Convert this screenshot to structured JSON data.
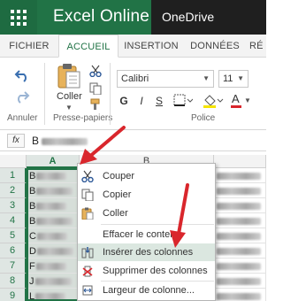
{
  "topbar": {
    "app_title": "Excel Online",
    "service": "OneDrive"
  },
  "tabs": [
    {
      "label": "FICHIER",
      "active": false
    },
    {
      "label": "ACCUEIL",
      "active": true
    },
    {
      "label": "INSERTION",
      "active": false
    },
    {
      "label": "DONNÉES",
      "active": false
    },
    {
      "label": "RÉ",
      "active": false
    }
  ],
  "ribbon": {
    "undo_group_label": "Annuler",
    "clipboard_group_label": "Presse-papiers",
    "paste_label": "Coller",
    "font_group_label": "Police",
    "font_name": "Calibri",
    "font_size": "11",
    "bold": "G",
    "italic": "I",
    "underline": "S",
    "font_color": "A"
  },
  "formula_bar": {
    "fx_label": "fx",
    "value_prefix": "B"
  },
  "grid": {
    "columns": [
      "A",
      "B"
    ],
    "rows": [
      "1",
      "2",
      "3",
      "4",
      "5",
      "6",
      "7",
      "8",
      "9"
    ],
    "cells_a_prefix": [
      "B",
      "B",
      "B",
      "B",
      "C",
      "D",
      "F",
      "J",
      "L"
    ]
  },
  "context_menu": {
    "items": [
      {
        "label": "Couper",
        "icon": "scissors-icon"
      },
      {
        "label": "Copier",
        "icon": "copy-icon"
      },
      {
        "label": "Coller",
        "icon": "paste-icon"
      },
      {
        "label": "Effacer le contenu",
        "icon": ""
      },
      {
        "label": "Insérer des colonnes",
        "icon": "insert-columns-icon",
        "highlighted": true
      },
      {
        "label": "Supprimer des colonnes",
        "icon": "delete-columns-icon"
      },
      {
        "label": "Largeur de colonne...",
        "icon": "column-width-icon"
      }
    ]
  },
  "colors": {
    "excel_green": "#217346",
    "arrow_red": "#d9262c",
    "onedrive_bar": "#1f1f1f"
  }
}
